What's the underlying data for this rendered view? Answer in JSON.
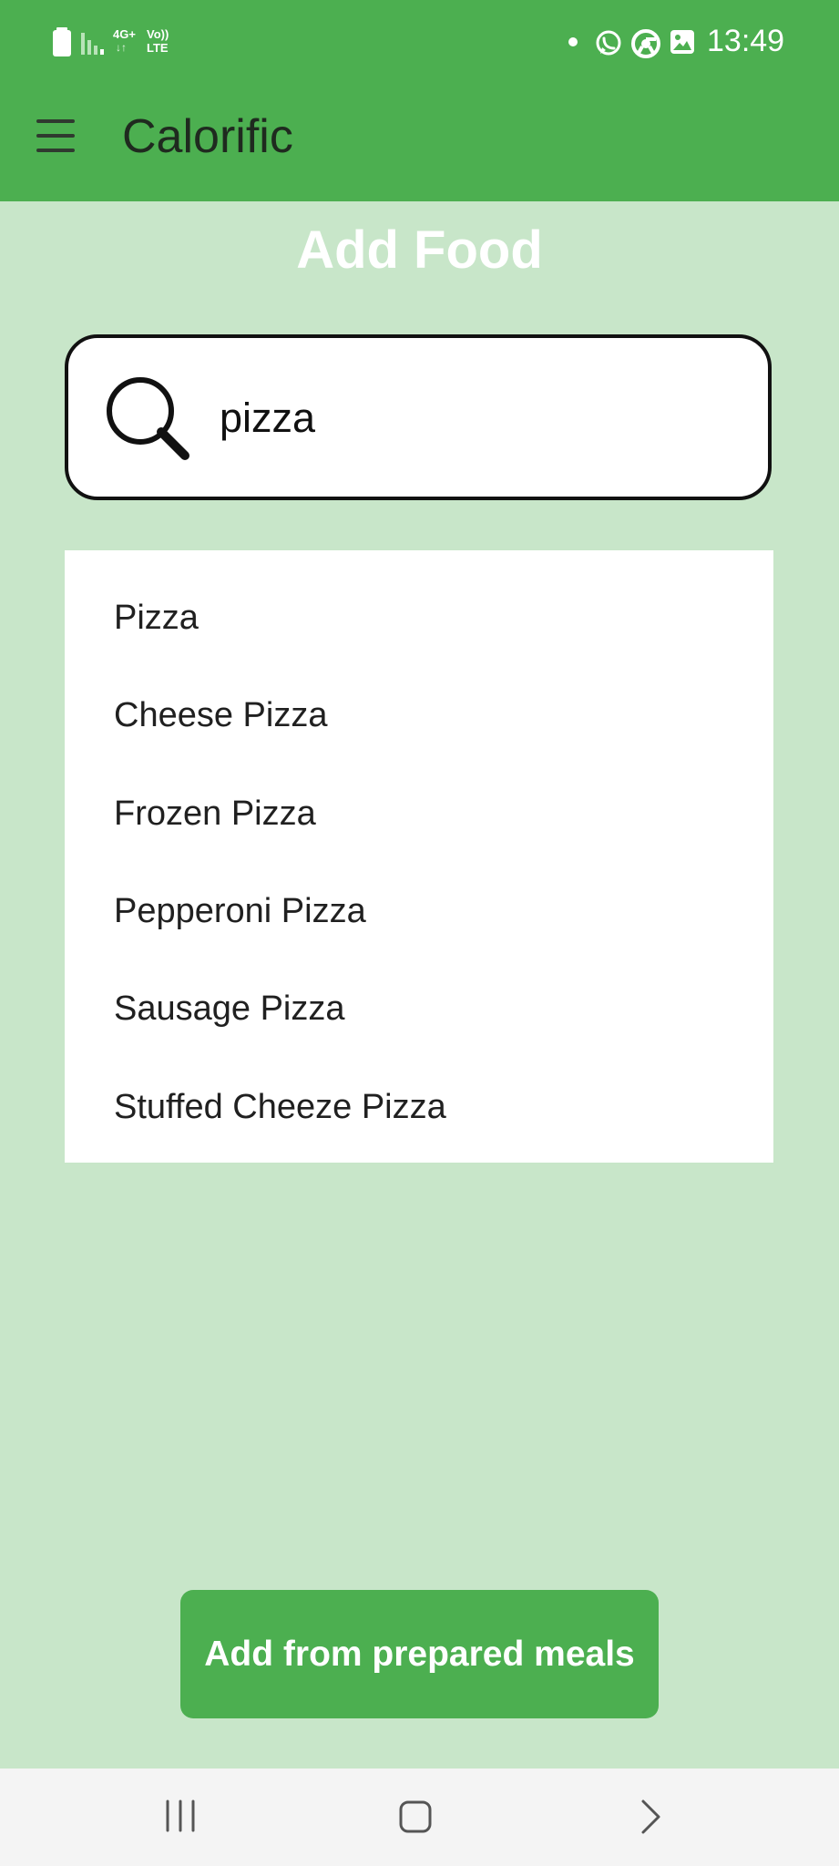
{
  "status_bar": {
    "network_label_top": "4G+",
    "volte_label": "Vo))",
    "lte_label": "LTE",
    "time": "13:49"
  },
  "app_bar": {
    "title": "Calorific"
  },
  "page": {
    "title": "Add Food"
  },
  "search": {
    "value": "pizza"
  },
  "results": [
    {
      "label": "Pizza"
    },
    {
      "label": "Cheese Pizza"
    },
    {
      "label": "Frozen Pizza"
    },
    {
      "label": "Pepperoni Pizza"
    },
    {
      "label": "Sausage Pizza"
    },
    {
      "label": "Stuffed Cheeze Pizza"
    }
  ],
  "actions": {
    "prepared_meals": "Add from prepared meals"
  },
  "colors": {
    "primary": "#4caf50",
    "background": "#c8e6c9",
    "nav_background": "#f4f4f4"
  }
}
